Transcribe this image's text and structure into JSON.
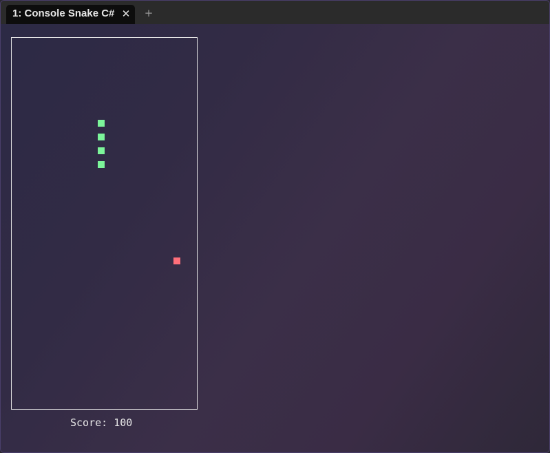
{
  "window": {
    "tab_title": "1: Console Snake C#",
    "close_glyph": "✕",
    "new_tab_glyph": "+"
  },
  "game": {
    "board": {
      "cols": 27,
      "rows": 27
    },
    "snake_color": "#7cf59a",
    "food_color": "#ff6f7a",
    "snake": [
      {
        "col": 13,
        "row": 6
      },
      {
        "col": 13,
        "row": 7
      },
      {
        "col": 13,
        "row": 8
      },
      {
        "col": 13,
        "row": 9
      }
    ],
    "food": {
      "col": 24,
      "row": 16
    },
    "score_text": "Score: 100"
  }
}
